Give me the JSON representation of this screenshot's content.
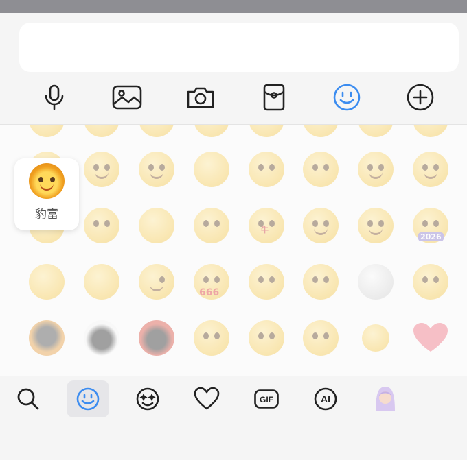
{
  "input": {
    "placeholder": "",
    "value": ""
  },
  "toolbar": {
    "icons": [
      "microphone-icon",
      "image-icon",
      "camera-icon",
      "red-packet-icon",
      "emoji-icon",
      "plus-icon"
    ],
    "active_index": 4,
    "accent_color": "#3b8cf0"
  },
  "preview": {
    "label": "豹富"
  },
  "emoji_rows": [
    [
      "partial-face",
      "partial-face",
      "partial-face",
      "partial-face",
      "partial-face",
      "partial-face",
      "partial-face",
      "partial-face"
    ],
    [
      "lion-face",
      "saluting-face",
      "laughing-face",
      "blank-face",
      "face-with-fish",
      "face-with-carp",
      "grinning-face",
      "smirking-face"
    ],
    [
      "wave-hands-face",
      "pat-head-face",
      "cover-face",
      "hug-face",
      "fan-face",
      "blushing-face",
      "squinting-face",
      "2026-face"
    ],
    [
      "lion-glitter-face",
      "cover-eyes-face",
      "wink-face",
      "666-face",
      "kiss-face",
      "sad-face",
      "moon-face",
      "meh-face"
    ],
    [
      "tiger-penguin",
      "bunny-penguin",
      "dino-penguin",
      "hat-face-1",
      "hat-face-2",
      "hug-red-face",
      "green-shirt-figure",
      "heart"
    ]
  ],
  "emoji_text": {
    "number_2026": "2026",
    "number_666": "666",
    "fan_char": "牛"
  },
  "bottom_tabs": [
    "search-icon",
    "emoji-tab-icon",
    "sparkle-emoji-icon",
    "heart-icon",
    "gif-icon",
    "ai-icon",
    "avatar-icon"
  ],
  "bottom_tab_labels": {
    "gif": "GIF",
    "ai": "AI"
  },
  "bottom_selected_index": 1
}
